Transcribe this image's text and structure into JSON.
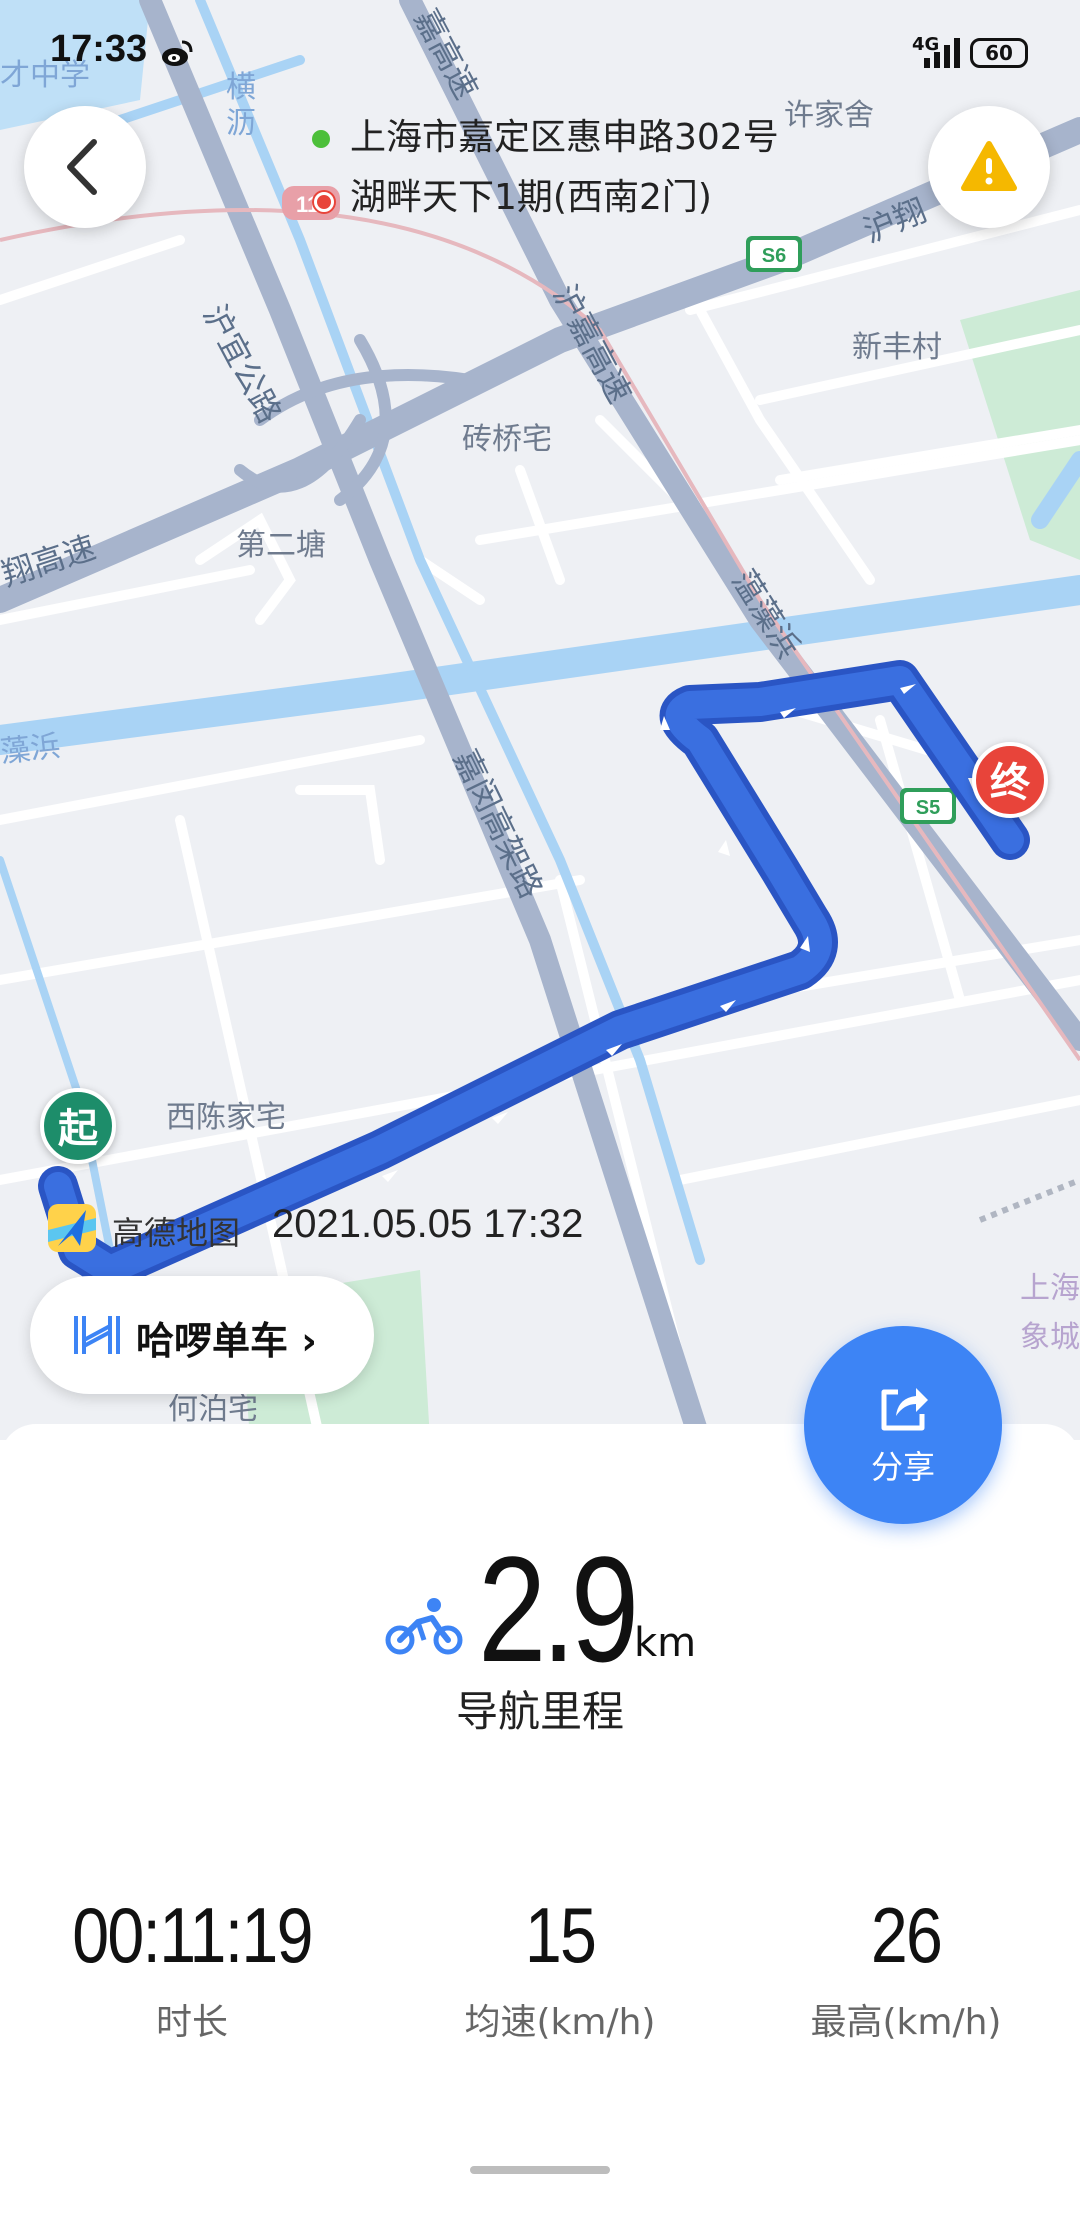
{
  "status_bar": {
    "time": "17:33",
    "network": "4G",
    "battery": "60"
  },
  "map_labels": [
    {
      "text": "才中学",
      "style": "blue"
    },
    {
      "text": "许家舍",
      "style": ""
    },
    {
      "text": "沪翔",
      "style": "road"
    },
    {
      "text": "沪宜公路",
      "style": "road"
    },
    {
      "text": "嘉高速",
      "style": "road"
    },
    {
      "text": "沪嘉高速",
      "style": "road"
    },
    {
      "text": "新丰村",
      "style": ""
    },
    {
      "text": "砖桥宅",
      "style": ""
    },
    {
      "text": "第二塘",
      "style": ""
    },
    {
      "text": "翔高速",
      "style": "road"
    },
    {
      "text": "蕰藻浜",
      "style": "road"
    },
    {
      "text": "藻浜",
      "style": "blue"
    },
    {
      "text": "嘉闵高架路",
      "style": "road"
    },
    {
      "text": "西陈家宅",
      "style": ""
    },
    {
      "text": "横沥",
      "style": "blue"
    },
    {
      "text": "S6",
      "style": "shield"
    },
    {
      "text": "S5",
      "style": "shield"
    },
    {
      "text": "上海",
      "style": "purple"
    },
    {
      "text": "象城",
      "style": "purple"
    },
    {
      "text": "何泊宅",
      "style": ""
    }
  ],
  "route": {
    "start_address": "上海市嘉定区惠申路302号",
    "end_address": "湖畔天下1期(西南2门)"
  },
  "markers": {
    "start": "起",
    "end": "终"
  },
  "watermark": {
    "brand": "高德地图",
    "timestamp": "2021.05.05 17:32"
  },
  "provider_chip": {
    "label": "哈啰单车"
  },
  "share": {
    "label": "分享"
  },
  "summary": {
    "distance_value": "2.9",
    "distance_unit": "km",
    "distance_label": "导航里程",
    "stats": [
      {
        "value": "00:11:19",
        "label": "时长"
      },
      {
        "value": "15",
        "label": "均速(km/h)"
      },
      {
        "value": "26",
        "label": "最高(km/h)"
      }
    ]
  },
  "colors": {
    "route": "#3a6fe0",
    "route_outline": "#2a55c4",
    "share_button": "#3d84f5",
    "start_marker": "#1d8d6a",
    "end_marker": "#e8443a",
    "river": "#a9d3f5"
  }
}
